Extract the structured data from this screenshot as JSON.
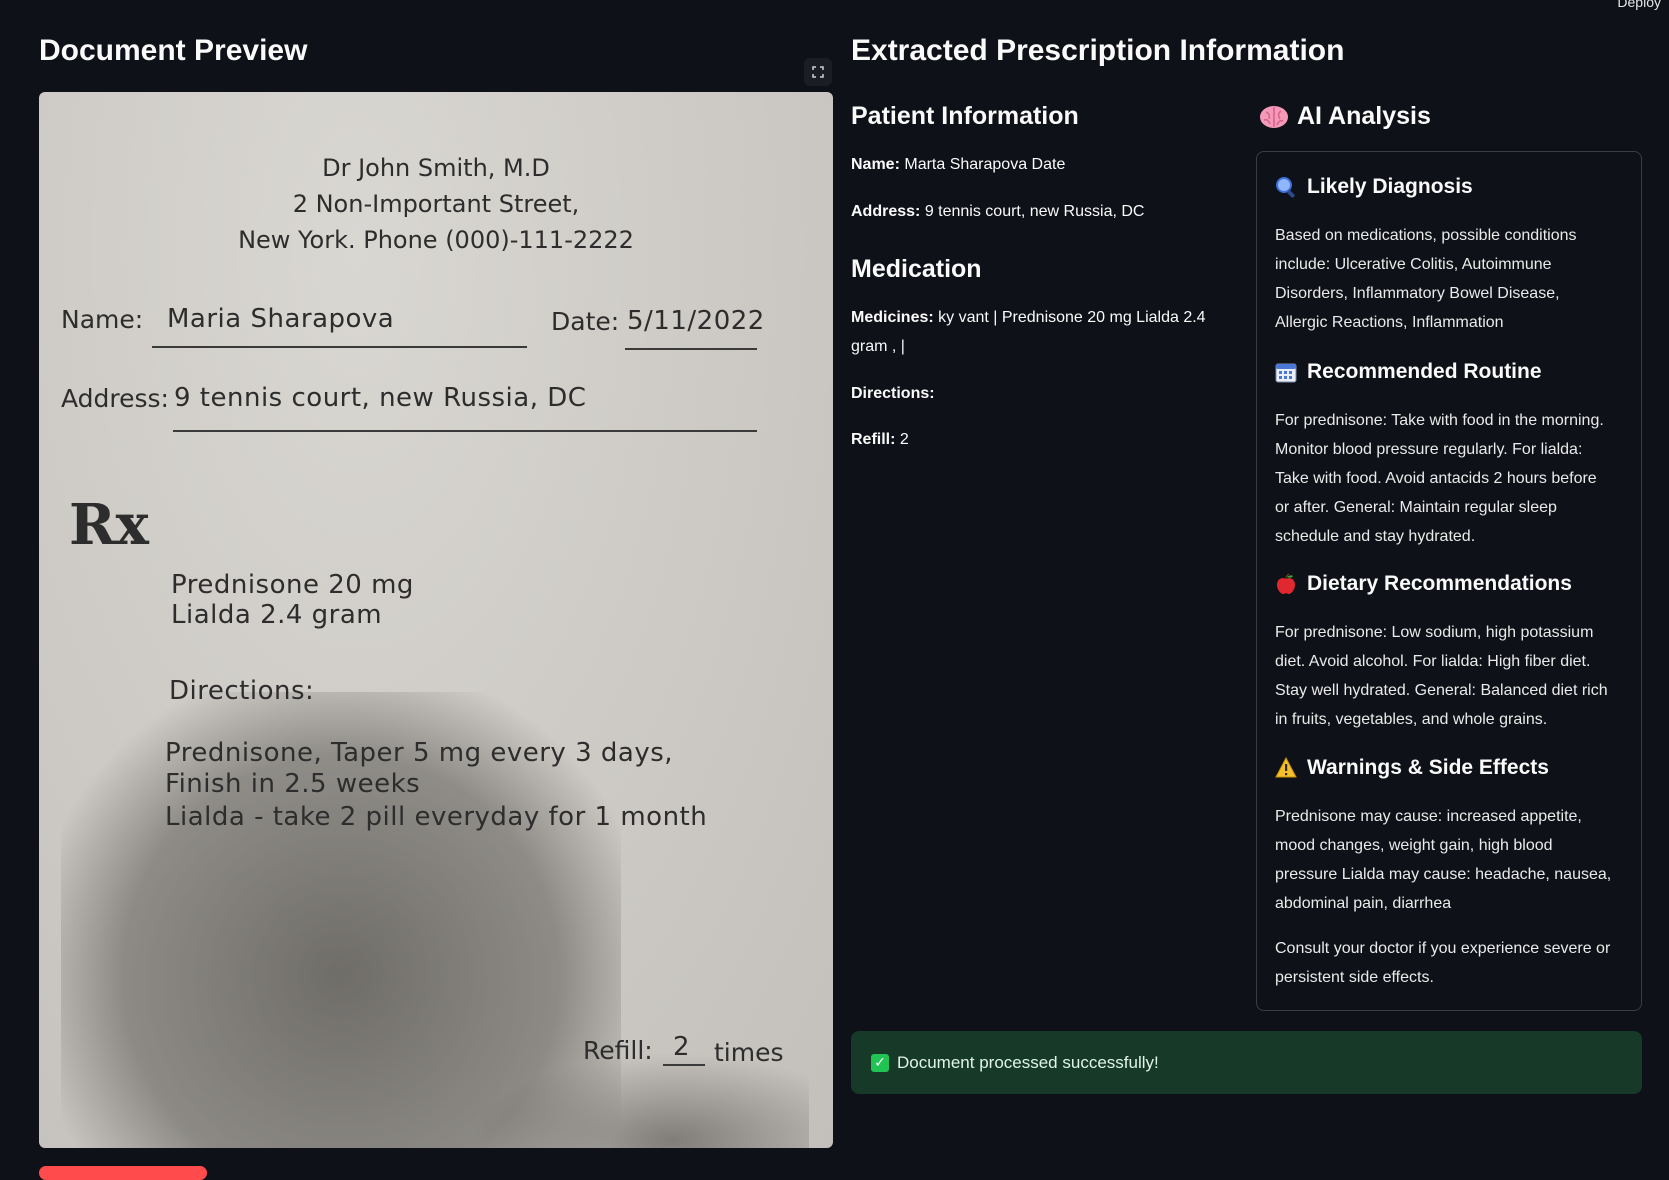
{
  "topbar": {
    "deploy_label": "Deploy"
  },
  "preview": {
    "title": "Document Preview",
    "document": {
      "doctor": "Dr John Smith, M.D",
      "street": "2 Non-Important Street,",
      "city_phone": "New York. Phone (000)-111-2222",
      "name_label": "Name:",
      "name_value": "Maria Sharapova",
      "date_label": "Date:",
      "date_value": "5/11/2022",
      "address_label": "Address:",
      "address_value": "9 tennis court, new Russia, DC",
      "rx_symbol": "Rx",
      "med_line1": "Prednisone 20 mg",
      "med_line2": "Lialda 2.4 gram",
      "directions_label": "Directions:",
      "dir_line1": "Prednisone, Taper 5 mg every 3 days,",
      "dir_line2": "Finish in 2.5 weeks",
      "dir_line3": "Lialda - take 2 pill everyday for 1 month",
      "refill_label": "Refill:",
      "refill_value": "2",
      "refill_suffix": "times"
    }
  },
  "extracted": {
    "title": "Extracted Prescription Information",
    "patient": {
      "heading": "Patient Information",
      "name_label": "Name:",
      "name_value": "Marta Sharapova Date",
      "address_label": "Address:",
      "address_value": "9 tennis court, new Russia, DC"
    },
    "medication": {
      "heading": "Medication",
      "medicines_label": "Medicines:",
      "medicines_value": "ky vant | Prednisone 20 mg Lialda 2.4",
      "medicines_value_2": "gram , |",
      "directions_label": "Directions:",
      "refill_label": "Refill:",
      "refill_value": "2"
    },
    "ai": {
      "heading": "AI Analysis",
      "sections": [
        {
          "icon": "magnifier-icon",
          "title": "Likely Diagnosis",
          "lines": [
            "Based on medications, possible conditions",
            "include: Ulcerative Colitis, Autoimmune",
            "Disorders, Inflammatory Bowel Disease,",
            "Allergic Reactions, Inflammation"
          ]
        },
        {
          "icon": "calendar-icon",
          "title": "Recommended Routine",
          "lines": [
            "For prednisone: Take with food in the morning.",
            "Monitor blood pressure regularly. For lialda:",
            "Take with food. Avoid antacids 2 hours before",
            "or after. General: Maintain regular sleep",
            "schedule and stay hydrated."
          ]
        },
        {
          "icon": "apple-icon",
          "title": "Dietary Recommendations",
          "lines": [
            "For prednisone: Low sodium, high potassium",
            "diet. Avoid alcohol. For lialda: High fiber diet.",
            "Stay well hydrated. General: Balanced diet rich",
            "in fruits, vegetables, and whole grains."
          ]
        },
        {
          "icon": "warning-icon",
          "title": "Warnings & Side Effects",
          "lines": [
            "Prednisone may cause: increased appetite,",
            "mood changes, weight gain, high blood",
            "pressure Lialda may cause: headache, nausea,",
            "abdominal pain, diarrhea"
          ],
          "extra_lines": [
            "Consult your doctor if you experience severe or",
            "persistent side effects."
          ]
        }
      ]
    },
    "success_message": "Document processed successfully!"
  },
  "colors": {
    "background": "#0e1117",
    "success_bg": "#173928",
    "success_check": "#21c354",
    "danger": "#ff4b4b"
  }
}
